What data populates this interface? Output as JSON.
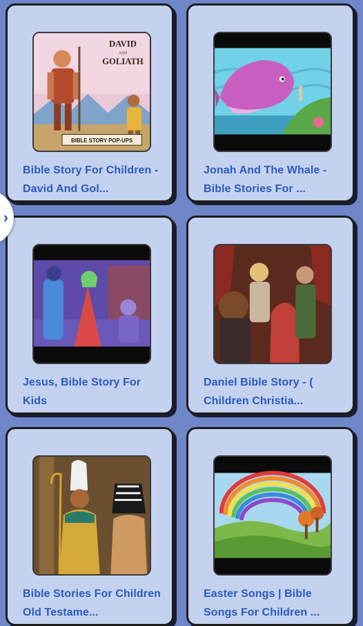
{
  "items": [
    {
      "title": "Bible Story For Children - David And Gol...",
      "thumb": "david-goliath",
      "thumb_text": [
        "DAVID",
        "AND",
        "GOLIATH",
        "BIBLE STORY POP-UPS"
      ]
    },
    {
      "title": "Jonah And The Whale - Bible Stories For ...",
      "thumb": "jonah-whale"
    },
    {
      "title": "Jesus, Bible Story For Kids",
      "thumb": "jesus"
    },
    {
      "title": "Daniel Bible Story - ( Children Christia...",
      "thumb": "daniel"
    },
    {
      "title": "Bible Stories For Children Old Testame...",
      "thumb": "old-testament"
    },
    {
      "title": "Easter Songs | Bible Songs For Children ...",
      "thumb": "easter-rainbow"
    }
  ],
  "side_tab": {
    "icon": "chevron-right-icon",
    "glyph": "›"
  },
  "colors": {
    "background": "#6f87c9",
    "card": "#c4d2ef",
    "title": "#2a5bbd"
  }
}
